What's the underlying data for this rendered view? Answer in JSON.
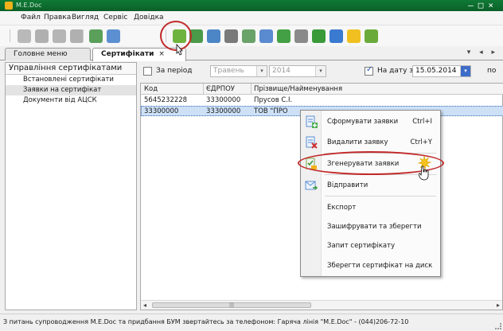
{
  "window": {
    "title": "M.E.Doc",
    "controls": "—□×"
  },
  "menu": [
    "Файл",
    "Правка",
    "Вигляд",
    "Сервіс",
    "Довідка"
  ],
  "toolbar": {
    "buttons": [
      {
        "icon": "doc-gray-icon",
        "color": "#b9b9b9"
      },
      {
        "icon": "doc-gray-2-icon",
        "color": "#b0b0b0"
      },
      {
        "icon": "copy-gray-icon",
        "color": "#b5b5b5"
      },
      {
        "icon": "edit-gray-icon",
        "color": "#b0b0b0"
      },
      {
        "icon": "add-request-icon",
        "color": "#5aa05a"
      },
      {
        "icon": "delete-request-icon",
        "color": "#5c8fd1"
      },
      {
        "icon": "generate-requests-icon",
        "color": "#6fb33f"
      },
      {
        "icon": "send-icon",
        "color": "#4a9a4a"
      },
      {
        "icon": "save-icon",
        "color": "#4d86c6"
      },
      {
        "icon": "print-icon",
        "color": "#7a7a7a"
      },
      {
        "icon": "receive-mail-icon",
        "color": "#6aa36a"
      },
      {
        "icon": "tools-icon",
        "color": "#5a8ad0"
      },
      {
        "icon": "filter-icon",
        "color": "#44a044"
      },
      {
        "icon": "clear-filter-icon",
        "color": "#8a8a8a"
      },
      {
        "icon": "refresh-icon",
        "color": "#3a9a3a"
      },
      {
        "icon": "globe-icon",
        "color": "#3a7ad0"
      },
      {
        "icon": "help-icon",
        "color": "#f0c020"
      },
      {
        "icon": "export-menu-icon",
        "color": "#6aaa3a"
      }
    ]
  },
  "tabs": [
    {
      "label": "Головне меню",
      "active": false
    },
    {
      "label": "Сертифікати",
      "active": true,
      "close": "×"
    }
  ],
  "tab_nav": "▾ ◂ ▸",
  "left_panel": {
    "header": "Управління сертифікатами",
    "items": [
      {
        "label": "Встановлені сертифікати",
        "selected": false
      },
      {
        "label": "Заявки на сертифікат",
        "selected": true
      },
      {
        "label": "Документи від АЦСК",
        "selected": false
      }
    ]
  },
  "filter": {
    "period_label": "За період",
    "month": "Травень",
    "year": "2014",
    "date_label": "На дату з",
    "date_value": "15.05.2014",
    "to_label": "по"
  },
  "grid": {
    "columns": [
      "Код",
      "ЄДРПОУ",
      "Прізвище/Найменування"
    ],
    "rows": [
      {
        "code": "5645232228",
        "edrpou": "33300000",
        "name": "Прусов С.І.",
        "selected": false
      },
      {
        "code": "33300000",
        "edrpou": "33300000",
        "name": "ТОВ \"ПРО",
        "selected": true
      }
    ],
    "scroll_thumb": "|||"
  },
  "context_menu": {
    "items": [
      {
        "label": "Сформувати заявки",
        "shortcut": "Ctrl+I",
        "icon": "form-requests-icon"
      },
      {
        "label": "Видалити заявку",
        "shortcut": "Ctrl+Y",
        "icon": "delete-request-icon"
      },
      {
        "label": "Згенерувати заявки",
        "shortcut": "",
        "icon": "generate-requests-icon"
      },
      {
        "label": "Відправити",
        "shortcut": "",
        "icon": "send-icon"
      },
      {
        "label": "Експорт",
        "shortcut": "",
        "icon": ""
      },
      {
        "label": "Зашифрувати та зберегти",
        "shortcut": "",
        "icon": ""
      },
      {
        "label": "Запит сертифікату",
        "shortcut": "",
        "icon": ""
      },
      {
        "label": "Зберегти сертифікат на диск",
        "shortcut": "",
        "icon": ""
      }
    ]
  },
  "status": "З питань супроводження M.E.Doc та придбання БУМ звертайтесь за телефоном: Гаряча лінія \"M.E.Doc\" - (044)206-72-10",
  "colors": {
    "callout": "#c12929",
    "selection": "#cde0f6",
    "title_bar": "#0f7a36"
  }
}
